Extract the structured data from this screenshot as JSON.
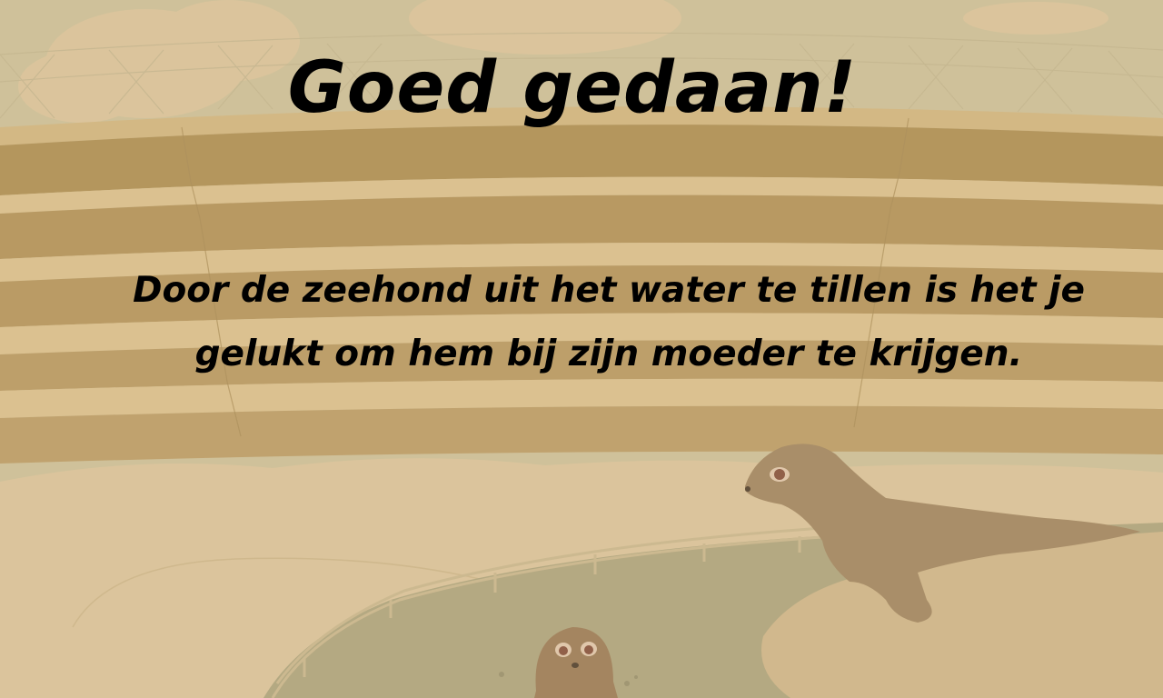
{
  "scene": {
    "title": "Goed gedaan!",
    "message": "Door de zeehond uit het water te tillen is het je gelukt om hem bij zijn moeder te krijgen."
  },
  "palette": {
    "sky": "#cfc39a",
    "cloud": "#ddc79b",
    "stand_light": "#dcc08c",
    "stand_dark": "#b08c4e",
    "ground": "#dcc59c",
    "water": "#aba27a",
    "rock": "#cfb588",
    "seal": "#9a7d58",
    "seal_pup": "#93714d"
  }
}
